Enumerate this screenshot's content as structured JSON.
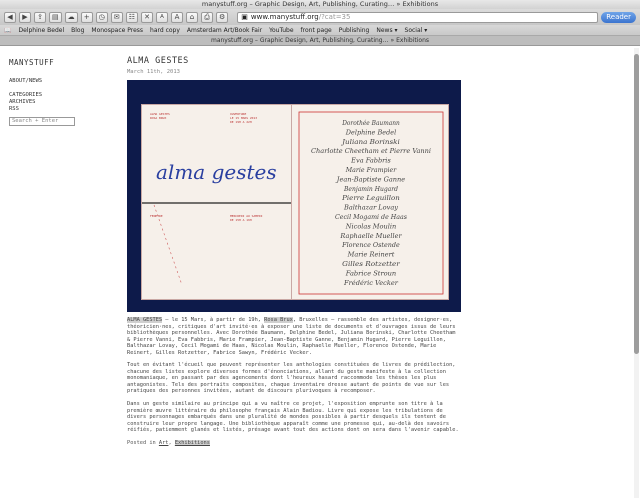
{
  "window": {
    "title": "manystuff.org – Graphic Design, Art, Publishing, Curating… » Exhibitions"
  },
  "toolbar": {
    "url_host": "www.manystuff.org",
    "url_path": "/?cat=35",
    "reader_label": "Reader",
    "font_small": "A",
    "font_large": "A"
  },
  "bookmarks": [
    "Delphine Bedel",
    "Blog",
    "Monospace Press",
    "hard copy",
    "Amsterdam Art/Book Fair",
    "YouTube",
    "front page",
    "Publishing",
    "News ▾",
    "Social ▾"
  ],
  "tab": {
    "title": "manystuff.org – Graphic Design, Art, Publishing, Curating… » Exhibitions"
  },
  "sidebar": {
    "site_title": "MANYSTUFF",
    "links_top": [
      "ABOUT/NEWS"
    ],
    "links_bottom": [
      "CATEGORIES",
      "ARCHIVES",
      "RSS"
    ],
    "search_placeholder": "Search + Enter"
  },
  "post": {
    "title": "ALMA GESTES",
    "date": "March 11th, 2013",
    "image": {
      "left_script": "alma gestes",
      "left_small_lines": [
        "ALMA GESTES",
        "ROSA BRUX",
        "OUVERTURE",
        "LE 15 MARS 2013",
        "DE 19H A 22H",
        "FENETRE",
        "MERCREDI AU SAMEDI",
        "DE 15H A 19H"
      ],
      "names": [
        "Dorothée Baumann",
        "Delphine Bedel",
        "Juliana Borinski",
        "Charlotte Cheetham et Pierre Vanni",
        "Eva Fabbris",
        "Marie Frampier",
        "Jean-Baptiste Ganne",
        "Benjamin Hugard",
        "Pierre Leguillon",
        "Balthazar Lovay",
        "Cecil Mogami de Haas",
        "Nicolas Moulin",
        "Raphaelle Mueller",
        "Florence Ostende",
        "Marie Reinert",
        "Gilles Rotzetter",
        "Fabrice Stroun",
        "Frédéric Vecker"
      ]
    },
    "p1_lead": "ALMA GESTES",
    "p1_mid1": " – le 15 Mars, à partir de 19h, ",
    "p1_venue": "Rosa Brux",
    "p1_rest": ", Bruxelles – rassemble des artistes, designer·es, théoricien·nes, critiques d'art invité·es à exposer une liste de documents et d'ouvrages issus de leurs bibliothèques personnelles. Avec Dorothée Baumann, Delphine Bedel, Juliana Borinski, Charlotte Cheetham & Pierre Vanni, Eva Fabbris, Marie Frampier, Jean-Baptiste Ganne, Benjamin Hugard, Pierre Leguillon, Balthazar Lovay, Cecil Mogami de Haas, Nicolas Moulin, Raphaelle Mueller, Florence Ostende, Marie Reinert, Gilles Rotzetter, Fabrice Sawyn, Frédéric Vecker.",
    "p2": "Tout en évitant l'écueil que peuvent représenter les anthologies constituées de livres de prédilection, chacune des listes explore diverses formes d'énonciations, allant du geste manifeste à la collection monomaniaque, en passant par des agencements dont l'heureux hasard raccommode les thèses les plus antagonistes. Tels des portraits composites, chaque inventaire dresse autant de points de vue sur les pratiques des personnes invitées, autant de discours pluri­voques à recomposer.",
    "p3": "Dans un geste similaire au principe qui a vu naître ce projet, l'exposition emprunte son titre à la première œuvre littéraire du philosophe français Alain Badiou. Livre qui expose les tribulations de divers personnages embarqués dans une pluralité de mondes possibles à partir desquels ils tentent de construire leur propre langage. Une bibliothèque apparaît comme une promesse qui, au-delà des savoirs réifiés, patiemment glanés et listés, présage avant tout des actions dont on sera dans l'avenir capable.",
    "posted_prefix": "Posted in ",
    "cat1": "Art",
    "sep": ", ",
    "cat2": "Exhibitions"
  }
}
